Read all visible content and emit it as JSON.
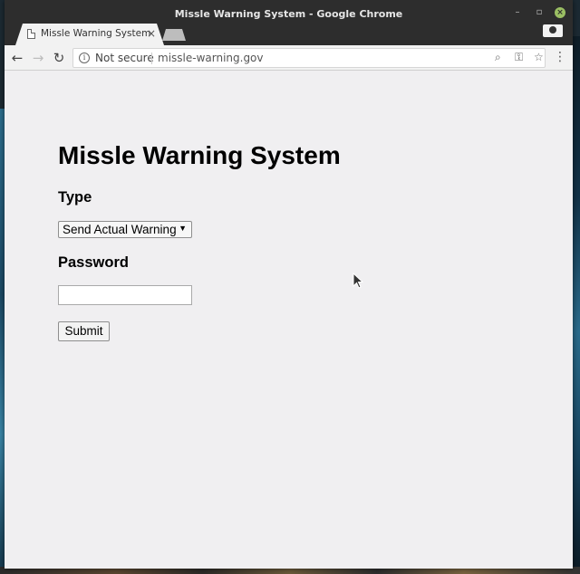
{
  "window": {
    "title": "Missle Warning System - Google Chrome",
    "controls": {
      "minimize": "–",
      "maximize": "▫",
      "close": "×"
    }
  },
  "tab": {
    "title": "Missle Warning System",
    "close": "×"
  },
  "toolbar": {
    "security_label": "Not secure",
    "url": "missle-warning.gov",
    "icons": [
      "back-icon",
      "forward-icon",
      "reload-icon",
      "info-icon",
      "zoom-icon",
      "key-icon",
      "star-icon",
      "menu-icon",
      "profile-icon"
    ]
  },
  "page": {
    "heading": "Missle Warning System",
    "type_label": "Type",
    "type_selected": "Send Actual Warning",
    "password_label": "Password",
    "password_value": "",
    "submit_label": "Submit"
  },
  "colors": {
    "titlebar": "#2d2d2d",
    "page_background": "#f0eff1",
    "close_button": "#9bbf63"
  }
}
